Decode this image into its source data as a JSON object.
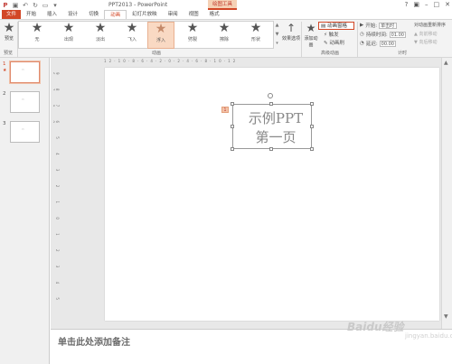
{
  "window": {
    "title": "PPT2013 - PowerPoint",
    "context_tab": "绘图工具"
  },
  "tabs": [
    "文件",
    "开始",
    "插入",
    "设计",
    "切换",
    "动画",
    "幻灯片放映",
    "审阅",
    "视图",
    "格式"
  ],
  "ribbon": {
    "preview_label": "预览",
    "preview_group": "预览",
    "animations": [
      "无",
      "出现",
      "淡出",
      "飞入",
      "浮入",
      "劈裂",
      "擦除",
      "形状"
    ],
    "selected_animation": "浮入",
    "effect_options": "效果选项",
    "animation_group": "动画",
    "add_animation": "添加动画",
    "animation_pane": "动画窗格",
    "trigger": "触发",
    "animation_painter": "动画刷",
    "advanced_group": "高级动画",
    "timing": {
      "start_label": "开始:",
      "start_value": "单击时",
      "duration_label": "持续时间:",
      "duration_value": "01.00",
      "delay_label": "延迟:",
      "delay_value": "00.00",
      "reorder_label": "对动画重新排序",
      "move_earlier": "向前移动",
      "move_later": "向后移动",
      "group": "计时"
    }
  },
  "slides": [
    {
      "num": "1",
      "mark": "★",
      "selected": true
    },
    {
      "num": "2",
      "selected": false
    },
    {
      "num": "3",
      "selected": false
    }
  ],
  "rulers": {
    "horizontal": "12·10·8·6·4·2·0·2·4·6·8·10·12",
    "vertical": "9 8 7 6 5 4 3 2 1 0 1 2 3 4 5 6 7 8 9"
  },
  "slide_content": {
    "title_line1": "示例PPT",
    "title_line2": "第一页",
    "anim_tag": "1"
  },
  "notes_placeholder": "单击此处添加备注",
  "watermark": "Baidu经验",
  "watermark_sub": "jingyan.baidu.com"
}
